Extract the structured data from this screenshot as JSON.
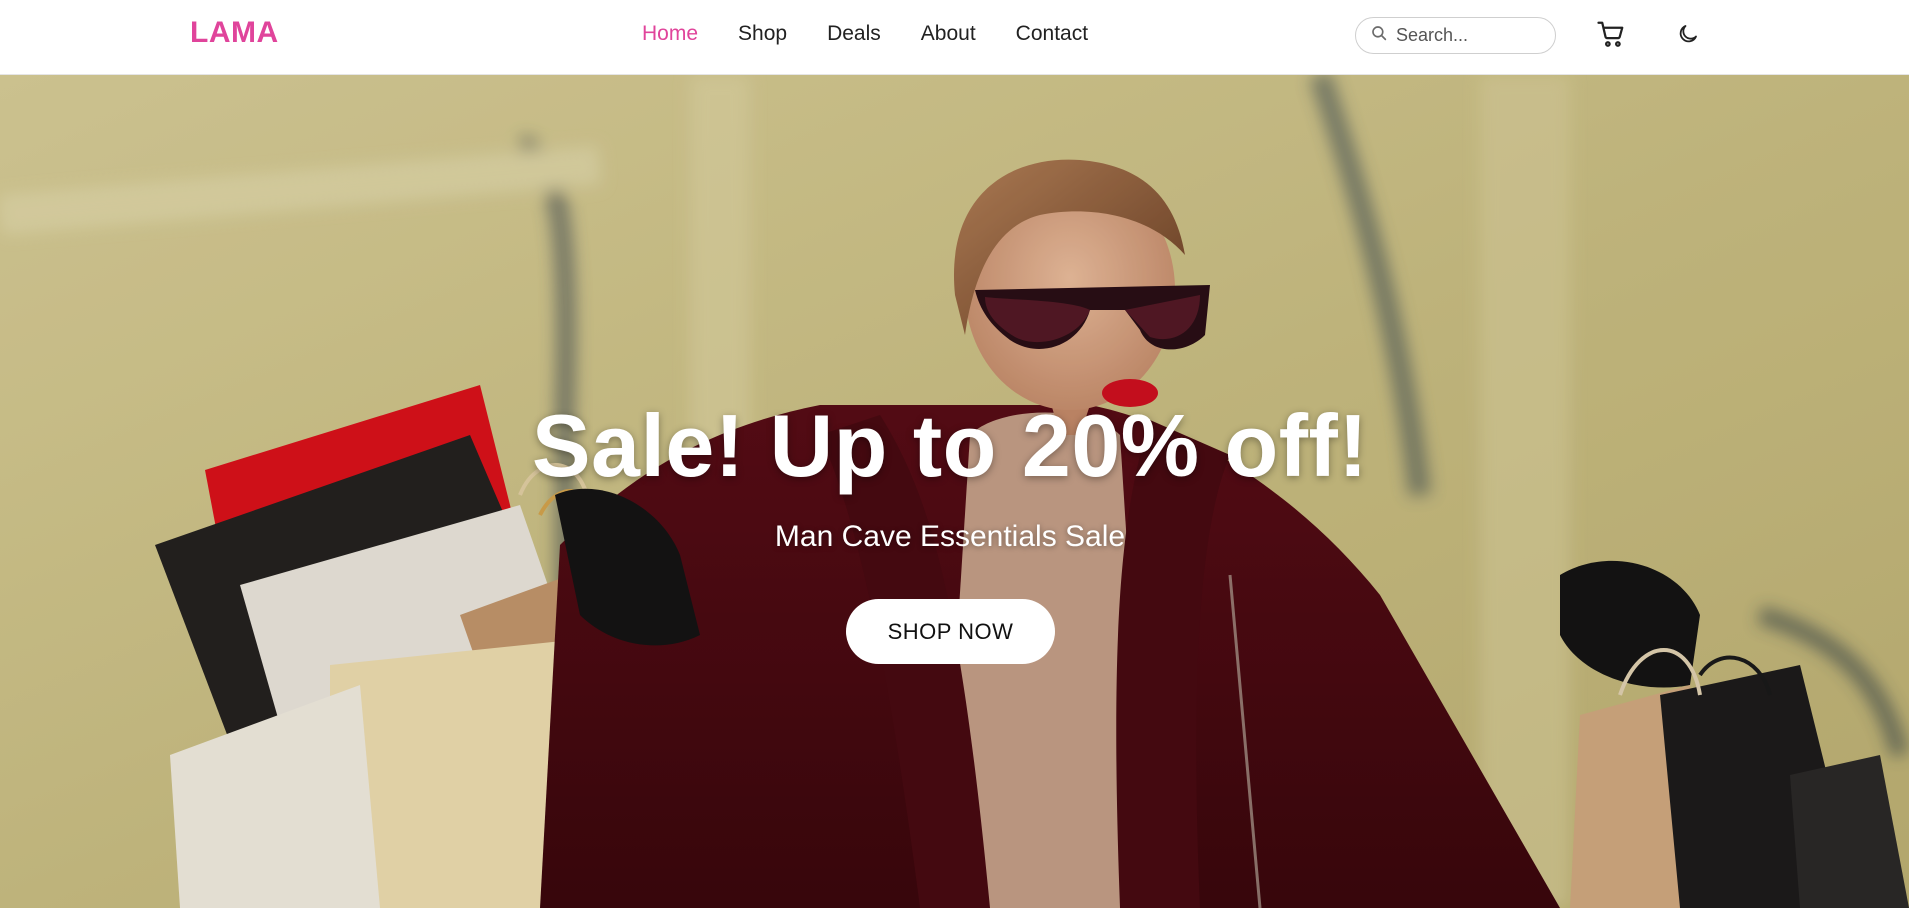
{
  "header": {
    "logo": "LAMA",
    "nav": [
      {
        "label": "Home",
        "active": true
      },
      {
        "label": "Shop",
        "active": false
      },
      {
        "label": "Deals",
        "active": false
      },
      {
        "label": "About",
        "active": false
      },
      {
        "label": "Contact",
        "active": false
      }
    ],
    "search": {
      "placeholder": "Search...",
      "value": "",
      "icon": "search-icon"
    },
    "cart_icon": "cart-icon",
    "theme_icon": "moon-icon"
  },
  "hero": {
    "title": "Sale! Up to 20% off!",
    "subtitle": "Man Cave Essentials Sale",
    "cta_label": "SHOP NOW"
  },
  "colors": {
    "accent": "#e0449b",
    "nav_text": "#222222",
    "hero_text": "#ffffff",
    "button_bg": "#ffffff"
  }
}
